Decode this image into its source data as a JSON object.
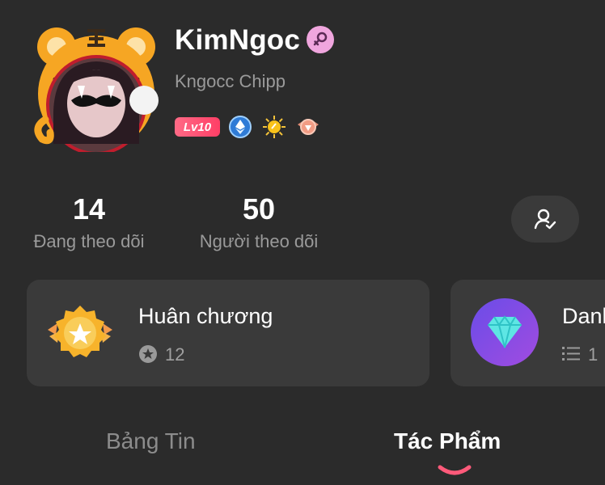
{
  "profile": {
    "display_name": "KimNgoc",
    "handle": "Kngocc Chipp",
    "gender_icon": "female-icon",
    "level_badge": "Lv10",
    "colors": {
      "gender_badge": "#f0a6de",
      "level_badge": "#ff4f70",
      "tab_underline": "#ff5a7a"
    }
  },
  "stats": {
    "following": {
      "value": "14",
      "label": "Đang theo dõi"
    },
    "followers": {
      "value": "50",
      "label": "Người theo dõi"
    }
  },
  "panels": {
    "medals": {
      "title": "Huân chương",
      "count": "12",
      "icon": "medal-icon"
    },
    "titles": {
      "title": "Danh",
      "count": "1",
      "icon": "diamond-icon"
    }
  },
  "tabs": [
    {
      "label": "Bảng Tin",
      "active": false
    },
    {
      "label": "Tác Phẩm",
      "active": true
    }
  ]
}
